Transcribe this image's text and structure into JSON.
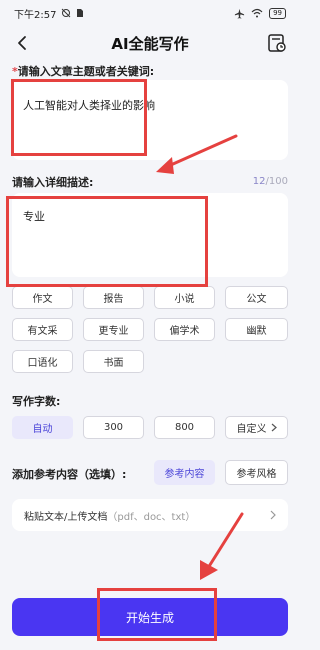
{
  "status": {
    "time": "下午2:57",
    "battery": "99"
  },
  "header": {
    "title": "AI全能写作"
  },
  "topic": {
    "required_mark": "*",
    "label": "请输入文章主题或者关键词:",
    "value": "人工智能对人类择业的影响"
  },
  "detail": {
    "label": "请输入详细描述:",
    "counter_current": "12",
    "counter_total": "/100",
    "value": "专业"
  },
  "style_tags": [
    "作文",
    "报告",
    "小说",
    "公文",
    "有文采",
    "更专业",
    "偏学术",
    "幽默",
    "口语化",
    "书面"
  ],
  "word_count": {
    "label": "写作字数:",
    "options": [
      "自动",
      "300",
      "800",
      "自定义"
    ],
    "selected": "自动"
  },
  "reference": {
    "label": "添加参考内容（选填）:",
    "buttons": [
      "参考内容",
      "参考风格"
    ],
    "selected": "参考内容",
    "paste_label": "粘贴文本/上传文档",
    "paste_hint": "（pdf、doc、txt）"
  },
  "generate": {
    "label": "开始生成"
  },
  "colors": {
    "primary": "#4a36f2",
    "chip_active_bg": "#e9e8fb",
    "chip_active_text": "#4b45d8",
    "annotation_red": "#e5413f",
    "background": "#f4f5f9"
  }
}
